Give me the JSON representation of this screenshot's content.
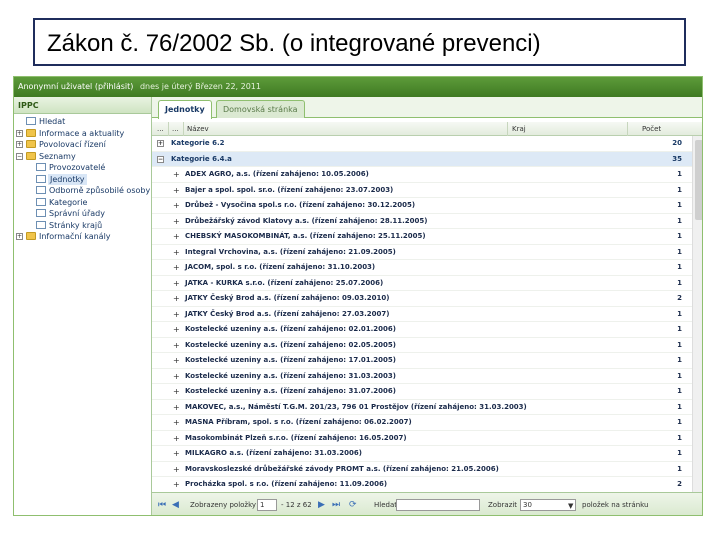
{
  "slide": {
    "title": "Zákon č. 76/2002 Sb. (o integrované prevenci)"
  },
  "app": {
    "header_user": "Anonymní uživatel (přihlásit)",
    "header_date": "dnes je úterý Březen 22, 2011"
  },
  "tree": {
    "title": "IPPC",
    "items": [
      {
        "label": "Hledat"
      },
      {
        "label": "Informace a aktuality"
      },
      {
        "label": "Povolovací řízení"
      },
      {
        "label": "Seznamy"
      },
      {
        "label": "Provozovatelé"
      },
      {
        "label": "Jednotky"
      },
      {
        "label": "Odborně způsobilé osoby"
      },
      {
        "label": "Kategorie"
      },
      {
        "label": "Správní úřady"
      },
      {
        "label": "Stránky krajů"
      },
      {
        "label": "Informační kanály"
      }
    ]
  },
  "tabs": {
    "active": "Jednotky",
    "inactive": "Domovská stránka"
  },
  "grid": {
    "col_dots1": "...",
    "col_dots2": "...",
    "col_name": "Název",
    "col_region": "Kraj",
    "col_count": "Počet",
    "rows": [
      {
        "name": "Kategorie 6.2",
        "count": "20"
      },
      {
        "name": "Kategorie 6.4.a",
        "count": "35"
      },
      {
        "name": "ADEX AGRO, a.s. (řízení zahájeno: 10.05.2006)",
        "count": "1"
      },
      {
        "name": "Bajer a spol. spol. sr.o. (řízení zahájeno: 23.07.2003)",
        "count": "1"
      },
      {
        "name": "Drůbež - Vysočina spol.s r.o. (řízení zahájeno: 30.12.2005)",
        "count": "1"
      },
      {
        "name": "Drůbežářský závod Klatovy a.s. (řízení zahájeno: 28.11.2005)",
        "count": "1"
      },
      {
        "name": "CHEBSKÝ MASOKOMBINÁT, a.s. (řízení zahájeno: 25.11.2005)",
        "count": "1"
      },
      {
        "name": "Integral Vrchovina, a.s. (řízení zahájeno: 21.09.2005)",
        "count": "1"
      },
      {
        "name": "JACOM, spol. s r.o. (řízení zahájeno: 31.10.2003)",
        "count": "1"
      },
      {
        "name": "JATKA - KURKA s.r.o. (řízení zahájeno: 25.07.2006)",
        "count": "1"
      },
      {
        "name": "JATKY Český Brod a.s. (řízení zahájeno: 09.03.2010)",
        "count": "2"
      },
      {
        "name": "JATKY Český Brod a.s. (řízení zahájeno: 27.03.2007)",
        "count": "1"
      },
      {
        "name": "Kostelecké uzeniny a.s. (řízení zahájeno: 02.01.2006)",
        "count": "1"
      },
      {
        "name": "Kostelecké uzeniny a.s. (řízení zahájeno: 02.05.2005)",
        "count": "1"
      },
      {
        "name": "Kostelecké uzeniny a.s. (řízení zahájeno: 17.01.2005)",
        "count": "1"
      },
      {
        "name": "Kostelecké uzeniny a.s. (řízení zahájeno: 31.03.2003)",
        "count": "1"
      },
      {
        "name": "Kostelecké uzeniny a.s. (řízení zahájeno: 31.07.2006)",
        "count": "1"
      },
      {
        "name": "MAKOVEC, a.s., Náměstí T.G.M. 201/23, 796 01 Prostějov (řízení zahájeno: 31.03.2003)",
        "count": "1"
      },
      {
        "name": "MASNA Příbram, spol. s r.o. (řízení zahájeno: 06.02.2007)",
        "count": "1"
      },
      {
        "name": "Masokombinát Plzeň s.r.o. (řízení zahájeno: 16.05.2007)",
        "count": "1"
      },
      {
        "name": "MILKAGRO a.s. (řízení zahájeno: 31.03.2006)",
        "count": "1"
      },
      {
        "name": "Moravskoslezské drůbežářské závody PROMT a.s. (řízení zahájeno: 21.05.2006)",
        "count": "1"
      },
      {
        "name": "Procházka spol. s r.o. (řízení zahájeno: 11.09.2006)",
        "count": "2"
      }
    ]
  },
  "pager": {
    "shown_label": "Zobrazeny položky",
    "page_value": "1",
    "page_of": "- 12 z 62",
    "filter_label": "Hledat",
    "show_label": "Zobrazit",
    "per_page_value": "30",
    "per_page_suffix": "položek na stránku"
  }
}
